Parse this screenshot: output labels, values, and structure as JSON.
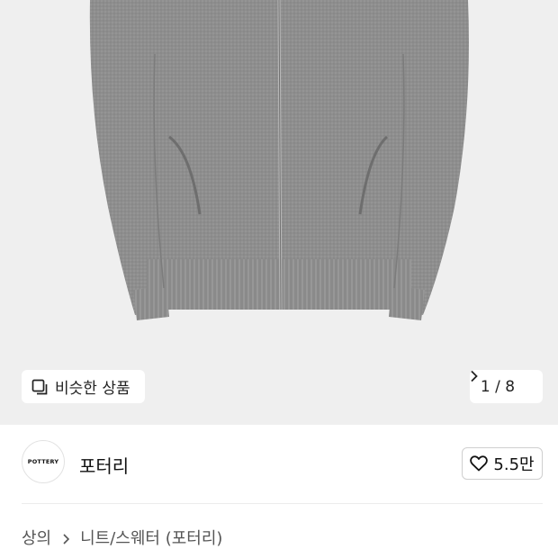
{
  "hero": {
    "similar_label": "비슷한 상품",
    "similar_icon": "copy-icon",
    "pager_text": "1 / 8",
    "pager_icon": "chevron-right-icon"
  },
  "store": {
    "logo_text": "POTTERY",
    "name": "포터리",
    "like_icon": "heart-icon",
    "like_count": "5.5만"
  },
  "breadcrumb": {
    "items": [
      "상의",
      "니트/스웨터 (포터리)"
    ],
    "separator_icon": "chevron-right-icon"
  },
  "colors": {
    "hero_bg": "#efefef",
    "sweater": "#8f8f8f",
    "text": "#111111",
    "muted": "#555555"
  }
}
